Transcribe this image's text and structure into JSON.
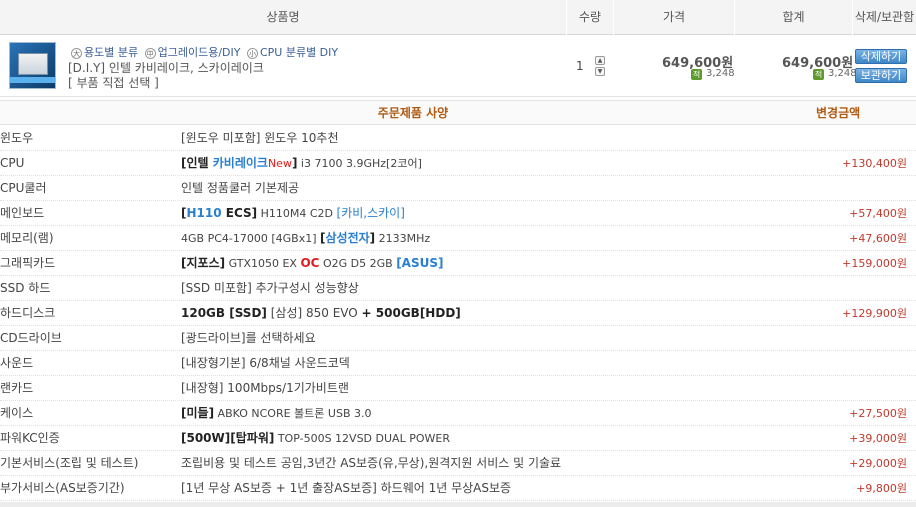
{
  "header": {
    "col_product": "상품명",
    "col_qty": "수량",
    "col_price": "가격",
    "col_total": "합계",
    "col_action": "삭제/보관함"
  },
  "product": {
    "thumb_icon": "cpu-box-image",
    "cat_prefix_1": "大",
    "cat_1": "용도별 분류",
    "cat_prefix_2": "中",
    "cat_2": "업그레이드용/DIY",
    "cat_prefix_3": "小",
    "cat_3": "CPU 분류별 DIY",
    "name": "[D.I.Y] 인텔 카비레이크, 스카이레이크",
    "option": "[ 부품 직접 선택 ]",
    "qty": "1",
    "price": "649,600원",
    "price_points": "3,248",
    "total": "649,600원",
    "total_points": "3,248",
    "delete_label": "삭제하기",
    "save_label": "보관하기",
    "points_icon_text": "적"
  },
  "spec_header": {
    "title": "주문제품 사양",
    "amount_title": "변경금액"
  },
  "specs": [
    {
      "label": "윈도우",
      "v1": "[윈도우 미포함] 윈도우 10추천",
      "amount": ""
    },
    {
      "label": "CPU",
      "v1": "[인텔 ",
      "v2": "카비레이크",
      "v3": "New",
      "v4": "]",
      "v5": " i3 7100 3.9GHz[2코어]",
      "amount": "+130,400원"
    },
    {
      "label": "CPU쿨러",
      "v1": "인텔 정품쿨러 기본제공",
      "amount": ""
    },
    {
      "label": "메인보드",
      "v1": "[",
      "v2": "H110",
      "v3": " ECS]",
      "v4": " H110M4 C2D ",
      "v5": "[카비,스카이]",
      "amount": "+57,400원"
    },
    {
      "label": "메모리(램)",
      "v1": "4GB PC4-17000 [4GBx1] ",
      "v2": "[",
      "v3": "삼성전자",
      "v4": "]",
      "v5": " 2133MHz",
      "amount": "+47,600원"
    },
    {
      "label": "그래픽카드",
      "v1": "[지포스]",
      "v2": " GTX1050 EX ",
      "v3": "OC",
      "v4": " O2G D5 2GB ",
      "v5": "[ASUS]",
      "amount": "+159,000원"
    },
    {
      "label": "SSD 하드",
      "v1": "[SSD 미포함] 추가구성시 성능향상",
      "amount": ""
    },
    {
      "label": "하드디스크",
      "v1": "120GB [SSD]",
      "v2": " [삼성] 850 EVO ",
      "v3": "+ 500GB[HDD]",
      "amount": "+129,900원"
    },
    {
      "label": "CD드라이브",
      "v1": "[광드라이브]를 선택하세요",
      "amount": ""
    },
    {
      "label": "사운드",
      "v1": "[내장형기본] 6/8채널 사운드코덱",
      "amount": ""
    },
    {
      "label": "랜카드",
      "v1": "[내장형] 100Mbps/1기가비트랜",
      "amount": ""
    },
    {
      "label": "케이스",
      "v1": "[미들]",
      "v2": " ABKO NCORE 볼트론 USB 3.0",
      "amount": "+27,500원"
    },
    {
      "label": "파워KC인증",
      "v1": "[500W][탑파워]",
      "v2": " TOP-500S 12VSD DUAL POWER",
      "amount": "+39,000원"
    },
    {
      "label": "기본서비스(조립 및 테스트)",
      "v1": "조립비용 및 테스트 공임,3년간 AS보증(유,무상),원격지원 서비스 및 기술료",
      "amount": "+29,000원"
    },
    {
      "label": "부가서비스(AS보증기간)",
      "v1": "[1년 무상 AS보증 + 1년 출장AS보증] 하드웨어 1년 무상AS보증",
      "amount": "+9,800원"
    }
  ]
}
